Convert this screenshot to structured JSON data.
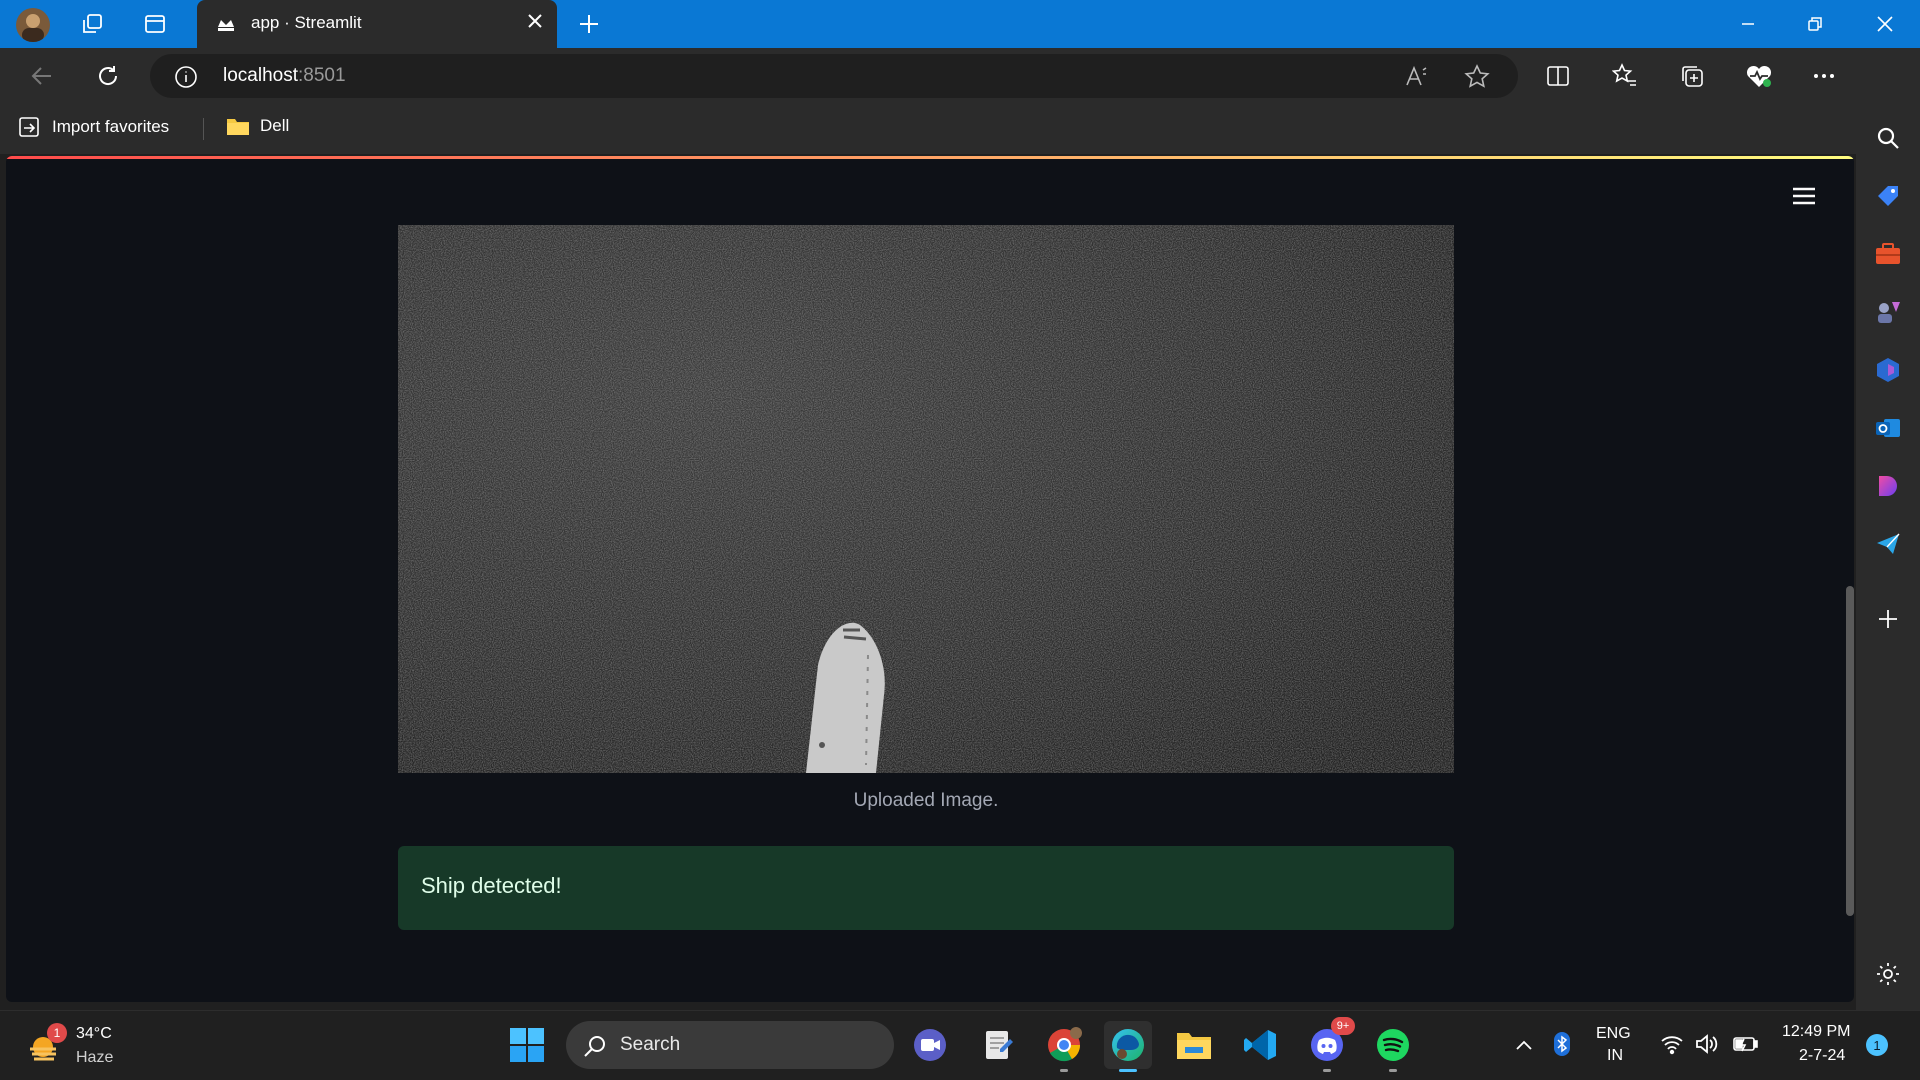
{
  "browser": {
    "tab_title": "app · Streamlit",
    "url_host": "localhost",
    "url_port": ":8501"
  },
  "favorites": {
    "import_label": "Import favorites",
    "folder_label": "Dell"
  },
  "page": {
    "image_caption": "Uploaded Image.",
    "alert_text": "Ship detected!",
    "colors": {
      "background": "#0e1117",
      "alert_bg": "#173928",
      "alert_text": "#dffde9"
    }
  },
  "taskbar": {
    "weather_temp": "34°C",
    "weather_desc": "Haze",
    "weather_badge": "1",
    "search_placeholder": "Search",
    "discord_badge": "9+",
    "lang_line1": "ENG",
    "lang_line2": "IN",
    "time": "12:49 PM",
    "date": "2-7-24",
    "notification_count": "1"
  }
}
